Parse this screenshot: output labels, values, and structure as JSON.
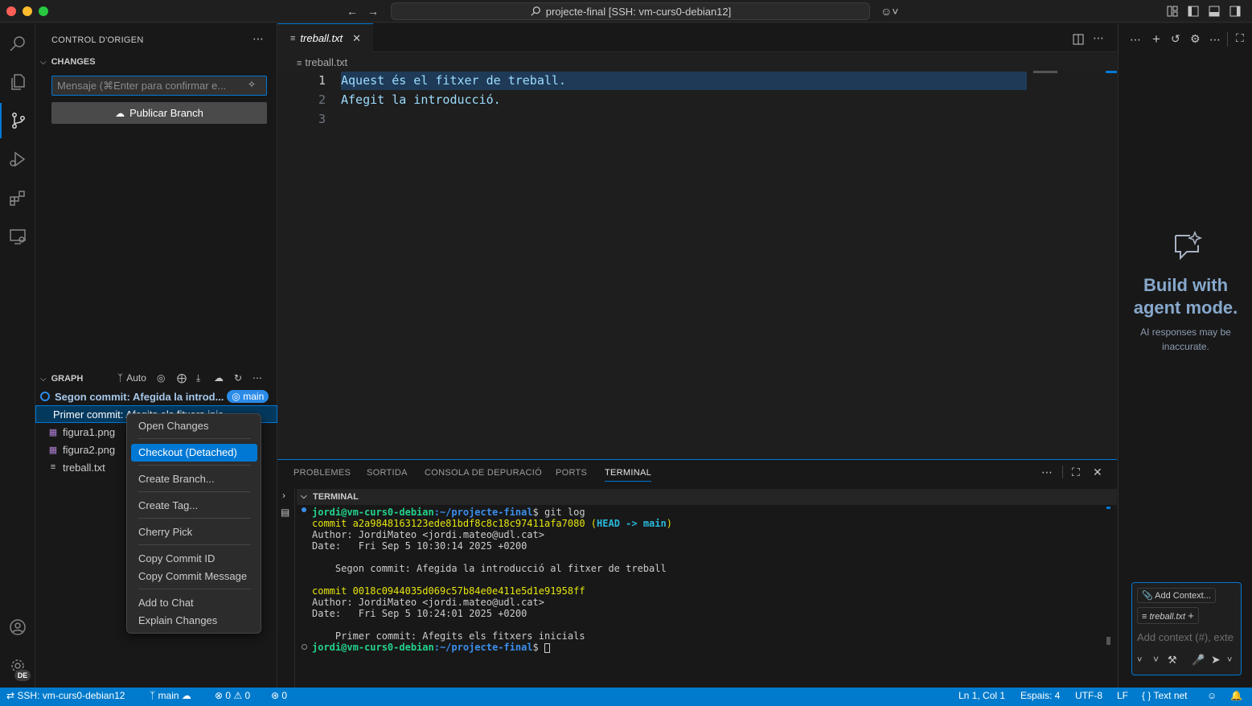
{
  "window": {
    "title": "projecte-final [SSH: vm-curs0-debian12]"
  },
  "sidebar": {
    "title": "CONTROL D'ORIGEN",
    "changes_header": "CHANGES",
    "commit_placeholder": "Mensaje (⌘Enter para confirmar e...",
    "publish_label": "Publicar Branch",
    "graph_header": "GRAPH",
    "graph_auto": "Auto",
    "commits": [
      {
        "message": "Segon commit: Afegida la introd...",
        "branch": "main"
      },
      {
        "message": "Primer commit: Afegits els fitxers inic..."
      }
    ],
    "files": [
      "figura1.png",
      "figura2.png",
      "treball.txt"
    ]
  },
  "context_menu": {
    "items": [
      "Open Changes",
      "Checkout (Detached)",
      "Create Branch...",
      "Create Tag...",
      "Cherry Pick",
      "Copy Commit ID",
      "Copy Commit Message",
      "Add to Chat",
      "Explain Changes"
    ],
    "selected": "Checkout (Detached)"
  },
  "editor": {
    "tab_label": "treball.txt",
    "breadcrumb": "treball.txt",
    "lines": [
      {
        "num": "1",
        "text": "Aquest és el fitxer de treball."
      },
      {
        "num": "2",
        "text": "Afegit la introducció."
      },
      {
        "num": "3",
        "text": ""
      }
    ]
  },
  "panel": {
    "tabs": [
      "PROBLEMES",
      "SORTIDA",
      "CONSOLA DE DEPURACIÓ",
      "PORTS",
      "TERMINAL"
    ],
    "active_tab": "TERMINAL",
    "terminal_header": "TERMINAL",
    "terminal": {
      "prompt_user": "jordi@vm-curs0-debian",
      "prompt_path": ":~/projecte-final",
      "command": "$ git log",
      "commit1_hash": "commit a2a9848163123ede81bdf8c8c18c97411afa7080",
      "commit1_ref_head": "HEAD -> main",
      "commit1_author": "Author: JordiMateo <jordi.mateo@udl.cat>",
      "commit1_date": "Date:   Fri Sep 5 10:30:14 2025 +0200",
      "commit1_msg": "    Segon commit: Afegida la introducció al fitxer de treball",
      "commit2_hash": "commit 0018c0944035d069c57b84e0e411e5d1e91958ff",
      "commit2_author": "Author: JordiMateo <jordi.mateo@udl.cat>",
      "commit2_date": "Date:   Fri Sep 5 10:24:01 2025 +0200",
      "commit2_msg": "    Primer commit: Afegits els fitxers inicials",
      "prompt_end": "$ "
    }
  },
  "chat": {
    "title": "Build with agent mode.",
    "subtitle": "AI responses may be inaccurate.",
    "add_context": "Add Context...",
    "file_chip": "treball.txt",
    "input_placeholder": "Add context (#), exte"
  },
  "statusbar": {
    "remote": "SSH: vm-curs0-debian12",
    "branch": "main",
    "errors": "0",
    "warnings": "0",
    "ports": "0",
    "position": "Ln 1, Col 1",
    "spaces": "Espais: 4",
    "encoding": "UTF-8",
    "eol": "LF",
    "language": "Text net"
  },
  "account_badge": "DE",
  "colors": {
    "accent": "#0078d4",
    "statusbar": "#007acc",
    "terminal_prompt_user": "#23d18b",
    "terminal_prompt_path": "#3b8eea",
    "terminal_commit": "#e5e510"
  }
}
